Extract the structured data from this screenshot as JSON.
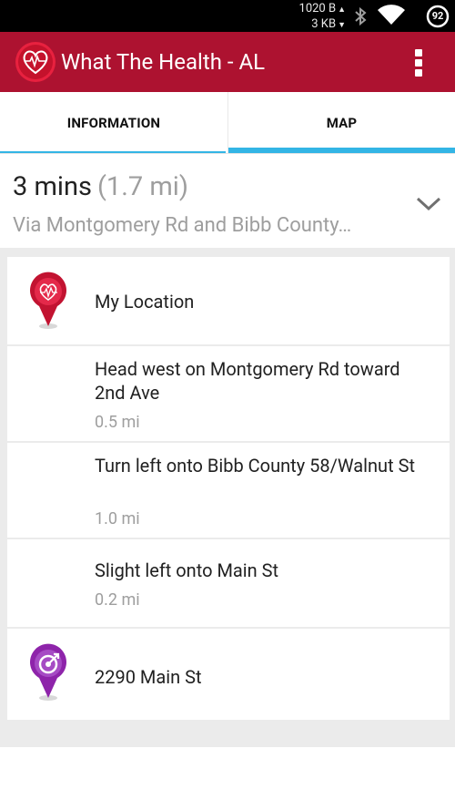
{
  "status_bar": {
    "speed_up": "1020 B",
    "speed_down": "3 KB",
    "battery": "92"
  },
  "app_bar": {
    "title": "What The Health - AL",
    "logo_icon": "heart-pulse-logo-icon",
    "menu_icon": "overflow-menu-icon"
  },
  "tabs": [
    {
      "label": "INFORMATION"
    },
    {
      "label": "MAP"
    }
  ],
  "route": {
    "duration": "3 mins",
    "distance": "(1.7 mi)",
    "via": "Via Montgomery Rd and Bibb County…"
  },
  "steps": [
    {
      "text": "My Location",
      "distance": ""
    },
    {
      "text": "Head west on Montgomery Rd toward 2nd Ave",
      "distance": "0.5 mi"
    },
    {
      "text": "Turn left onto Bibb County 58/Walnut St",
      "distance": "1.0 mi"
    },
    {
      "text": "Slight left onto Main St",
      "distance": "0.2 mi"
    },
    {
      "text": "2290 Main St",
      "distance": ""
    }
  ],
  "colors": {
    "app_bar": "#ad1230",
    "tab_indicator": "#33b5e5",
    "origin_pin": "#c21331",
    "destination_pin": "#8e24aa"
  }
}
